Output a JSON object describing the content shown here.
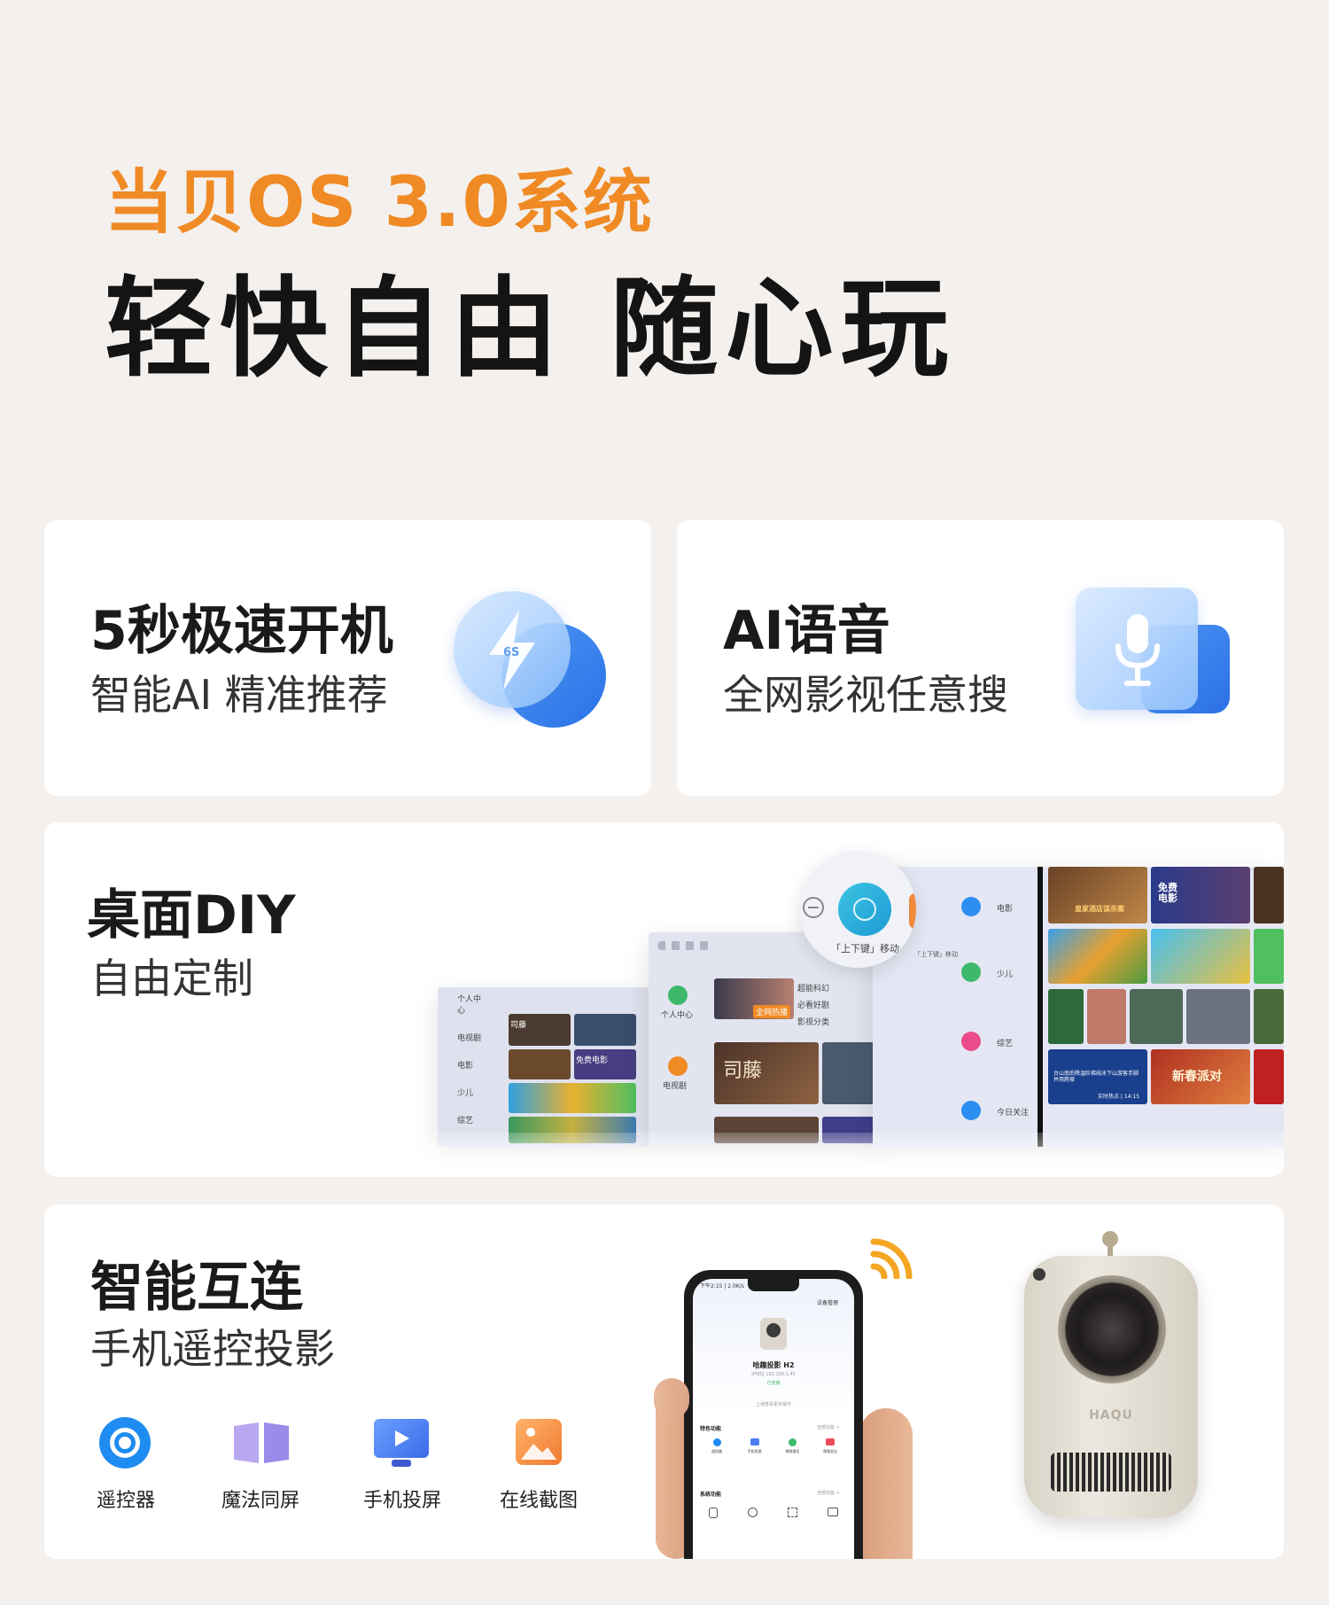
{
  "hero": {
    "subtitle": "当贝OS 3.0系统",
    "title": "轻快自由 随心玩"
  },
  "cards": {
    "boot": {
      "title": "5秒极速开机",
      "subtitle": "智能AI 精准推荐",
      "icon": "lightning-icon",
      "icon_text": "6S"
    },
    "voice": {
      "title": "AI语音",
      "subtitle": "全网影视任意搜",
      "icon": "microphone-icon"
    },
    "diy": {
      "title": "桌面DIY",
      "subtitle": "自由定制",
      "hint": "「上下键」移动",
      "hint_small": "「上下键」移动",
      "screen_left": {
        "menu": [
          "个人中心",
          "电视剧",
          "电影",
          "少儿",
          "综艺"
        ],
        "tile_labels": [
          "司藤",
          "免费电影"
        ]
      },
      "screen_mid": {
        "menu": [
          "个人中心",
          "电视剧"
        ],
        "tile_labels": [
          "全网热播",
          "超能科幻",
          "必看好剧",
          "影视分类",
          "司藤"
        ]
      },
      "screen_right": {
        "menu": [
          "电影",
          "少儿",
          "综艺",
          "今日关注"
        ],
        "tile_labels": [
          "皇家酒店谋杀案",
          "免费电影",
          "新春派对",
          "台山南后降温阶梯线冰下山游客手脚并用爬坡",
          "实时热点 | 14:15"
        ]
      }
    },
    "smart": {
      "title": "智能互连",
      "subtitle": "手机遥控投影",
      "features": [
        {
          "label": "遥控器",
          "icon": "remote-control-icon",
          "color": "#1e8cf0"
        },
        {
          "label": "魔法同屏",
          "icon": "book-icon",
          "color": "#9b8be8"
        },
        {
          "label": "手机投屏",
          "icon": "screen-cast-icon",
          "color": "#4a7df0"
        },
        {
          "label": "在线截图",
          "icon": "picture-icon",
          "color": "#f5963c"
        }
      ],
      "phone": {
        "status_time": "下午2:15 | 2.0K/s",
        "header_action": "设备管理",
        "device_name": "哈趣投影 H2",
        "device_ip": "IP地址 192.168.1.45",
        "connected": "已连接",
        "more_hint": "上滑查看更多操作",
        "special_title": "特色功能",
        "special_more": "全部功能 >",
        "special_items": [
          "遥控器",
          "手机投屏",
          "视频通话",
          "视频会议"
        ],
        "system_title": "系统功能",
        "system_more": "全部功能 >"
      },
      "projector_brand": "HAQU"
    }
  },
  "colors": {
    "accent_orange": "#f08a24",
    "background": "#f3f0ed",
    "card": "#ffffff",
    "blue": "#2c78ee"
  }
}
